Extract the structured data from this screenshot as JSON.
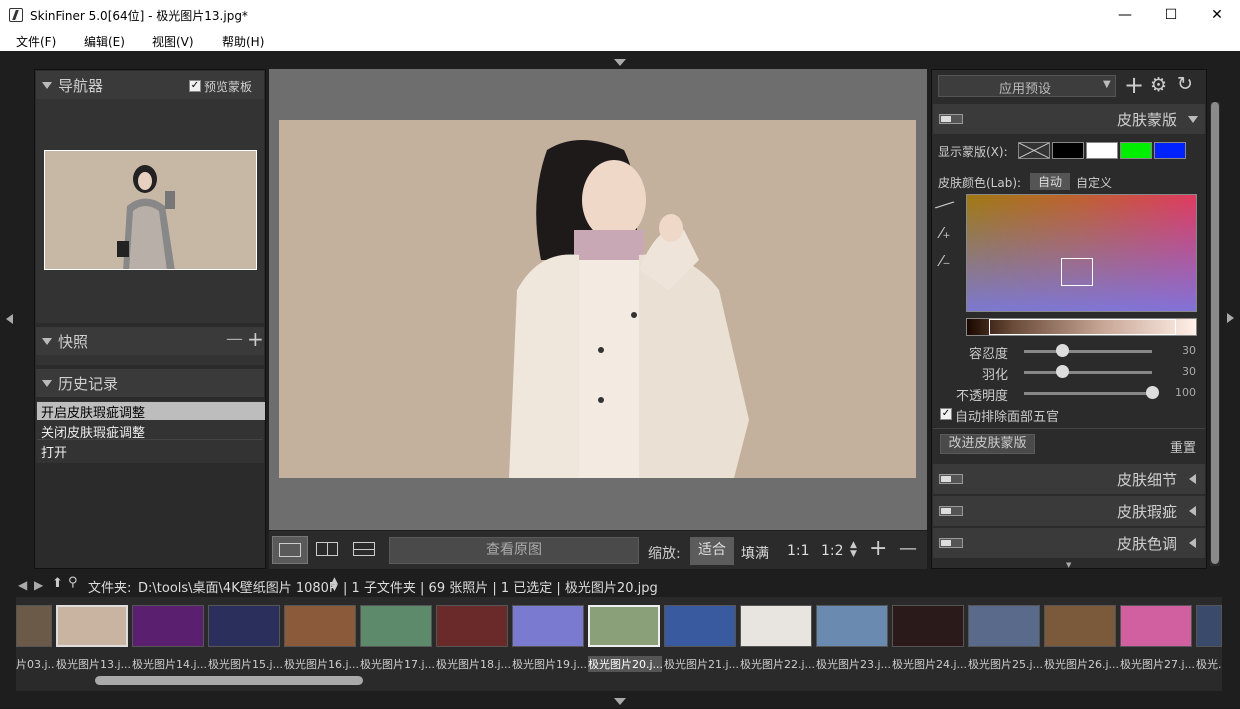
{
  "window": {
    "title": "SkinFiner 5.0[64位] - 极光图片13.jpg*",
    "minimize": "—",
    "maximize": "☐",
    "close": "✕"
  },
  "menu": [
    "文件(F)",
    "编辑(E)",
    "视图(V)",
    "帮助(H)"
  ],
  "navigator": {
    "title": "导航器",
    "preview_label": "预览蒙板",
    "preview_checked": true
  },
  "snapshot": {
    "title": "快照",
    "minus": "—",
    "plus": "+"
  },
  "history": {
    "title": "历史记录",
    "items": [
      "开启皮肤瑕疵调整",
      "关闭皮肤瑕疵调整",
      "打开"
    ]
  },
  "viewbar": {
    "view_original": "查看原图",
    "zoom_label": "缩放:",
    "zoom_fit": "适合",
    "zoom_fill": "填满",
    "zoom_1_1": "1:1",
    "zoom_1_2": "1:2",
    "plus": "+",
    "minus": "—"
  },
  "right": {
    "preset_label": "应用预设",
    "skin_mask": {
      "title": "皮肤蒙版",
      "show_mask_label": "显示蒙版(X):",
      "swatch_colors": [
        "#000000",
        "#ffffff",
        "#00ee00",
        "#0022ff"
      ],
      "skin_color_label": "皮肤颜色(Lab):",
      "auto": "自动",
      "custom": "自定义",
      "sliders": [
        {
          "label": "容忍度",
          "value": "30",
          "pos": 0.3
        },
        {
          "label": "羽化",
          "value": "30",
          "pos": 0.3
        },
        {
          "label": "不透明度",
          "value": "100",
          "pos": 1.0
        }
      ],
      "auto_exclude_label": "自动排除面部五官",
      "auto_exclude_checked": true,
      "refine_button": "改进皮肤蒙版",
      "reset": "重置"
    },
    "sections": [
      "皮肤细节",
      "皮肤瑕疵",
      "皮肤色调"
    ]
  },
  "pathbar": {
    "folder_label": "文件夹:",
    "path": "D:\\tools\\桌面\\4K壁纸图片 1080P",
    "info": "| 1 子文件夹 | 69 张照片 | 1 已选定 | 极光图片20.jpg"
  },
  "filmstrip": [
    {
      "label": "片03.j...",
      "color": "#6b5a48"
    },
    {
      "label": "极光图片13.j...",
      "color": "#c8b4a0"
    },
    {
      "label": "极光图片14.j...",
      "color": "#5a1f6e"
    },
    {
      "label": "极光图片15.j...",
      "color": "#2a2f5c"
    },
    {
      "label": "极光图片16.j...",
      "color": "#8a5a3a"
    },
    {
      "label": "极光图片17.j...",
      "color": "#5c8a6a"
    },
    {
      "label": "极光图片18.j...",
      "color": "#6a2a2a"
    },
    {
      "label": "极光图片19.j...",
      "color": "#7a7ad0"
    },
    {
      "label": "极光图片20.j...",
      "color": "#8aa078"
    },
    {
      "label": "极光图片21.j...",
      "color": "#3a5aa0"
    },
    {
      "label": "极光图片22.j...",
      "color": "#e8e4e0"
    },
    {
      "label": "极光图片23.j...",
      "color": "#6a8ab0"
    },
    {
      "label": "极光图片24.j...",
      "color": "#2a1a1a"
    },
    {
      "label": "极光图片25.j...",
      "color": "#5a6a8a"
    },
    {
      "label": "极光图片26.j...",
      "color": "#7a5a3a"
    },
    {
      "label": "极光图片27.j...",
      "color": "#d060a0"
    },
    {
      "label": "极光...",
      "color": "#3a4a6a"
    }
  ]
}
